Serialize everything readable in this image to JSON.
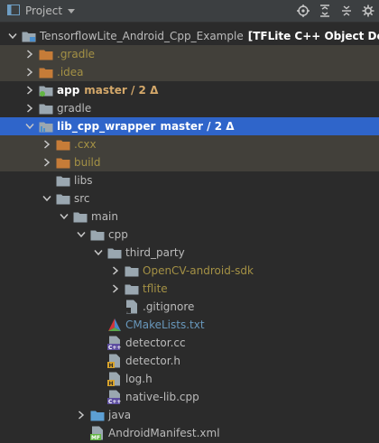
{
  "toolbar": {
    "title": "Project"
  },
  "tree": [
    {
      "label": "TensorflowLite_Android_Cpp_Example",
      "meta": "[TFLite C++ Object Detect",
      "depth": 0,
      "arrow": "down",
      "icon": "module-folder",
      "color": "c-default",
      "meta_color": "c-white bold"
    },
    {
      "label": ".gradle",
      "depth": 1,
      "arrow": "right",
      "icon": "folder-orange",
      "color": "c-ignored",
      "row": "hl"
    },
    {
      "label": ".idea",
      "depth": 1,
      "arrow": "right",
      "icon": "folder-orange",
      "color": "c-ignored",
      "row": "hl"
    },
    {
      "label": "app",
      "meta": "master / 2 Δ",
      "depth": 1,
      "arrow": "right",
      "icon": "module-dot",
      "color": "c-white bold",
      "meta_color": "c-branch"
    },
    {
      "label": "gradle",
      "depth": 1,
      "arrow": "right",
      "icon": "folder",
      "color": "c-default"
    },
    {
      "label": "lib_cpp_wrapper",
      "meta": "master / 2 Δ",
      "depth": 1,
      "arrow": "down",
      "icon": "module-bars",
      "color": "c-white bold",
      "meta_color": "c-selbranch",
      "row": "sel"
    },
    {
      "label": ".cxx",
      "depth": 2,
      "arrow": "right",
      "icon": "folder-orange",
      "color": "c-ignored",
      "row": "hl"
    },
    {
      "label": "build",
      "depth": 2,
      "arrow": "right",
      "icon": "folder-orange",
      "color": "c-ignored",
      "row": "hl"
    },
    {
      "label": "libs",
      "depth": 2,
      "arrow": "",
      "icon": "folder",
      "color": "c-default"
    },
    {
      "label": "src",
      "depth": 2,
      "arrow": "down",
      "icon": "folder",
      "color": "c-default"
    },
    {
      "label": "main",
      "depth": 3,
      "arrow": "down",
      "icon": "folder",
      "color": "c-default"
    },
    {
      "label": "cpp",
      "depth": 4,
      "arrow": "down",
      "icon": "folder",
      "color": "c-default"
    },
    {
      "label": "third_party",
      "depth": 5,
      "arrow": "down",
      "icon": "folder",
      "color": "c-default"
    },
    {
      "label": "OpenCV-android-sdk",
      "depth": 6,
      "arrow": "right",
      "icon": "folder",
      "color": "c-ignored"
    },
    {
      "label": "tflite",
      "depth": 6,
      "arrow": "right",
      "icon": "folder",
      "color": "c-ignored"
    },
    {
      "label": ".gitignore",
      "depth": 6,
      "arrow": "",
      "icon": "file-gitignore",
      "color": "c-default"
    },
    {
      "label": "CMakeLists.txt",
      "depth": 5,
      "arrow": "",
      "icon": "cmake",
      "color": "c-modified"
    },
    {
      "label": "detector.cc",
      "depth": 5,
      "arrow": "",
      "icon": "file-cpp",
      "color": "c-default"
    },
    {
      "label": "detector.h",
      "depth": 5,
      "arrow": "",
      "icon": "file-h",
      "color": "c-default"
    },
    {
      "label": "log.h",
      "depth": 5,
      "arrow": "",
      "icon": "file-h",
      "color": "c-default"
    },
    {
      "label": "native-lib.cpp",
      "depth": 5,
      "arrow": "",
      "icon": "file-cpp",
      "color": "c-default"
    },
    {
      "label": "java",
      "depth": 4,
      "arrow": "right",
      "icon": "folder-blue",
      "color": "c-default"
    },
    {
      "label": "AndroidManifest.xml",
      "depth": 4,
      "arrow": "",
      "icon": "file-mf",
      "color": "c-default"
    }
  ]
}
